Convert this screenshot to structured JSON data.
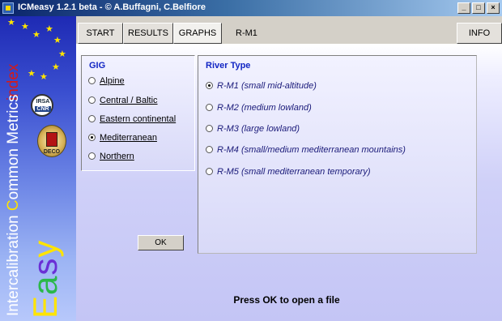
{
  "window": {
    "title": "ICMeasy 1.2.1 beta - © A.Buffagni, C.Belfiore",
    "minimize_label": "_",
    "maximize_label": "□",
    "close_label": "×"
  },
  "sidebar": {
    "vertical_title_left": "Intercalibration ",
    "vertical_title_highlight": "C",
    "vertical_title_rest": "ommon Metrics ",
    "vertical_index": "index",
    "logo_word_letters": [
      "E",
      "a",
      "s",
      "y"
    ],
    "badge_top": "IRSA",
    "badge_bottom": "CNR",
    "crest_label": "DECO"
  },
  "toolbar": {
    "tabs": [
      "START",
      "RESULTS",
      "GRAPHS"
    ],
    "active_tab": "GRAPHS",
    "breadcrumb": "R-M1",
    "info_label": "INFO"
  },
  "gig": {
    "title": "GIG",
    "options": [
      {
        "label": "Alpine",
        "selected": false
      },
      {
        "label": "Central / Baltic",
        "selected": false
      },
      {
        "label": "Eastern continental",
        "selected": false
      },
      {
        "label": "Mediterranean",
        "selected": true
      },
      {
        "label": "Northern",
        "selected": false
      }
    ],
    "ok_label": "OK"
  },
  "river_type": {
    "title": "River Type",
    "options": [
      {
        "label": "R-M1 (small mid-altitude)",
        "selected": true
      },
      {
        "label": "R-M2 (medium lowland)",
        "selected": false
      },
      {
        "label": "R-M3 (large lowland)",
        "selected": false
      },
      {
        "label": "R-M4 (small/medium mediterranean mountains)",
        "selected": false
      },
      {
        "label": "R-M5 (small mediterranean temporary)",
        "selected": false
      }
    ]
  },
  "status": {
    "message": "Press OK to open a file"
  },
  "colors": {
    "title_bar": "#0a246a",
    "panel_title": "#1226c4",
    "sidebar_top": "#1e2ab4",
    "logo_yellow": "#ffe400",
    "index_red": "#d51a1a"
  },
  "icons": {
    "app": "app-icon",
    "stars": "eu-star-icon",
    "badge": "irsa-cnr-logo-icon",
    "crest": "deco-crest-icon"
  }
}
